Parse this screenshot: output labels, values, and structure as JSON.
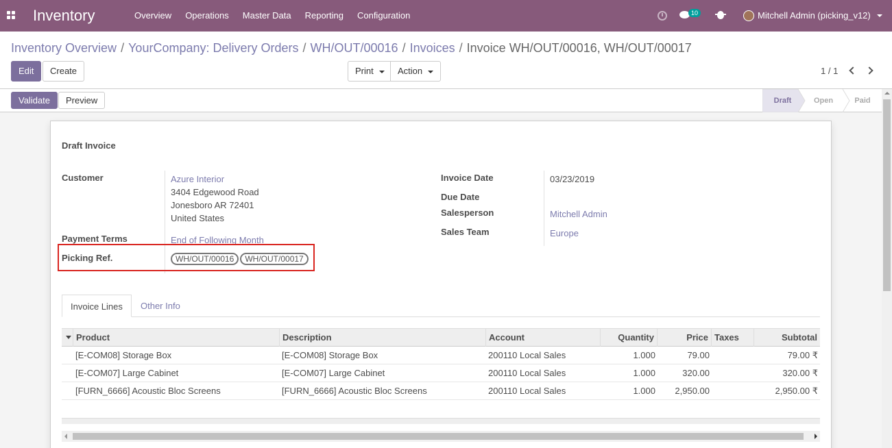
{
  "navbar": {
    "app_name": "Inventory",
    "menu": [
      "Overview",
      "Operations",
      "Master Data",
      "Reporting",
      "Configuration"
    ],
    "chat_count": "10",
    "user": "Mitchell Admin (picking_v12)"
  },
  "breadcrumb": {
    "items": [
      "Inventory Overview",
      "YourCompany: Delivery Orders",
      "WH/OUT/00016",
      "Invoices"
    ],
    "current": "Invoice WH/OUT/00016, WH/OUT/00017"
  },
  "buttons": {
    "edit": "Edit",
    "create": "Create",
    "print": "Print",
    "action": "Action",
    "validate": "Validate",
    "preview": "Preview"
  },
  "pager": {
    "value": "1 / 1"
  },
  "statusbar": {
    "stages": [
      "Draft",
      "Open",
      "Paid"
    ],
    "active": "Draft"
  },
  "form": {
    "title": "Draft Invoice",
    "customer_label": "Customer",
    "customer_name": "Azure Interior",
    "customer_address": [
      "3404 Edgewood Road",
      "Jonesboro AR 72401",
      "United States"
    ],
    "payment_terms_label": "Payment Terms",
    "payment_terms": "End of Following Month",
    "picking_ref_label": "Picking Ref.",
    "picking_refs": [
      "WH/OUT/00016",
      "WH/OUT/00017"
    ],
    "invoice_date_label": "Invoice Date",
    "invoice_date": "03/23/2019",
    "due_date_label": "Due Date",
    "salesperson_label": "Salesperson",
    "salesperson": "Mitchell Admin",
    "sales_team_label": "Sales Team",
    "sales_team": "Europe"
  },
  "tabs": [
    "Invoice Lines",
    "Other Info"
  ],
  "table": {
    "columns": [
      "Product",
      "Description",
      "Account",
      "Quantity",
      "Price",
      "Taxes",
      "Subtotal"
    ],
    "rows": [
      [
        "[E-COM08] Storage Box",
        "[E-COM08] Storage Box",
        "200110 Local Sales",
        "1.000",
        "79.00",
        "",
        "79.00 ₹"
      ],
      [
        "[E-COM07] Large Cabinet",
        "[E-COM07] Large Cabinet",
        "200110 Local Sales",
        "1.000",
        "320.00",
        "",
        "320.00 ₹"
      ],
      [
        "[FURN_6666] Acoustic Bloc Screens",
        "[FURN_6666] Acoustic Bloc Screens",
        "200110 Local Sales",
        "1.000",
        "2,950.00",
        "",
        "2,950.00 ₹"
      ]
    ]
  },
  "colors": {
    "brand": "#875a7b",
    "primary": "#7c6f9d",
    "link": "#7c7bad",
    "highlight": "#d9241f"
  }
}
